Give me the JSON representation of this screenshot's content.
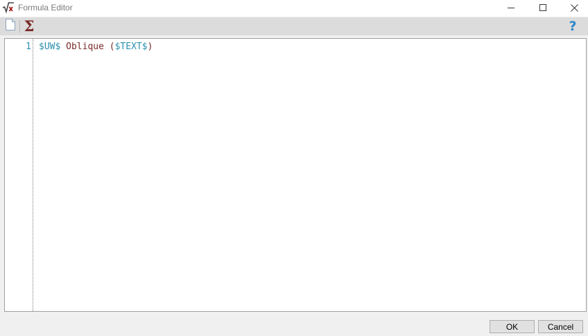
{
  "window": {
    "title": "Formula Editor",
    "icon": "square-root-x-icon",
    "controls": [
      "minimize-icon",
      "maximize-icon",
      "close-icon"
    ]
  },
  "toolbar": {
    "items": [
      {
        "name": "new-document-icon"
      },
      {
        "name": "sigma-icon",
        "glyph": "Σ"
      },
      {
        "name": "help-icon",
        "glyph": "?"
      }
    ]
  },
  "editor": {
    "lines": [
      {
        "number": "1",
        "tokens": [
          {
            "text": "$UW$",
            "kind": "variable"
          },
          {
            "text": " Oblique (",
            "kind": "text"
          },
          {
            "text": "$TEXT$",
            "kind": "variable"
          },
          {
            "text": ")",
            "kind": "text"
          }
        ]
      }
    ]
  },
  "buttons": {
    "ok_label": "OK",
    "cancel_label": "Cancel"
  },
  "colors": {
    "variable": "#2b91af",
    "text": "#7b2a2a",
    "help": "#2e86c8",
    "toolbar_bg": "#dcdcdc"
  }
}
